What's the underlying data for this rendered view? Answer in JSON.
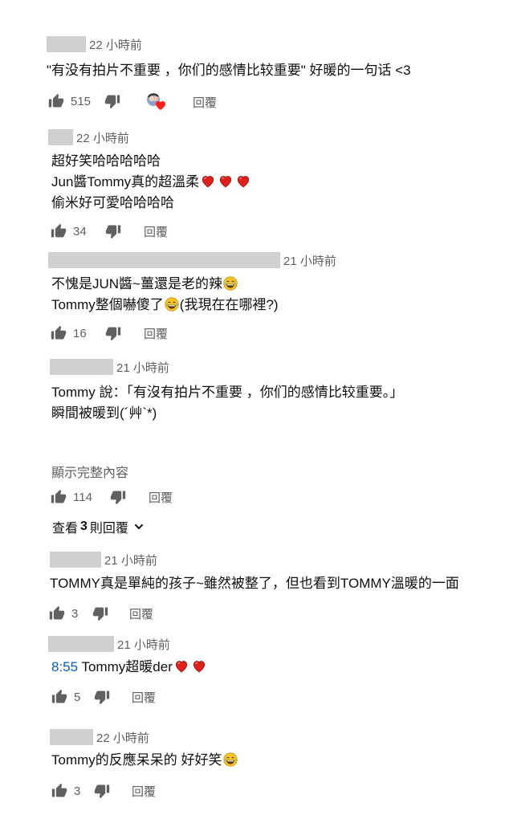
{
  "comments": [
    {
      "time": "22 小時前",
      "lines": [
        "\"有没有拍片不重要 ，你们的感情比较重要\" 好暖的一句话 <3"
      ],
      "likes": "515",
      "reply_label": "回覆",
      "creator_heart": true
    },
    {
      "time": "22 小時前",
      "lines": [
        "超好笑哈哈哈哈哈",
        "Jun醬Tommy真的超溫柔",
        "偷米好可愛哈哈哈哈"
      ],
      "likes": "34",
      "reply_label": "回覆"
    },
    {
      "time": "21 小時前",
      "lines": [
        "不愧是JUN醬~薑還是老的辣",
        "Tommy整個嚇傻了",
        "(我現在在哪裡?)"
      ],
      "likes": "16",
      "reply_label": "回覆"
    },
    {
      "time": "21 小時前",
      "lines": [
        "Tommy 說：「有沒有拍片不重要 ，你们的感情比较重要。」",
        "瞬間被暖到(´艸`*)"
      ],
      "show_more": "顯示完整內容",
      "likes": "114",
      "reply_label": "回覆",
      "view_replies": {
        "prefix": "查看",
        "count": "3",
        "suffix": "則回覆"
      }
    },
    {
      "time": "21 小時前",
      "lines": [
        "TOMMY真是單純的孩子~雖然被整了，但也看到TOMMY溫暖的一面"
      ],
      "likes": "3",
      "reply_label": "回覆"
    },
    {
      "time": "21 小時前",
      "timestamp_link": "8:55",
      "lines": [
        "Tommy超暖der"
      ],
      "likes": "5",
      "reply_label": "回覆"
    },
    {
      "time": "22 小時前",
      "lines": [
        "Tommy的反應呆呆的 好好笑"
      ],
      "likes": "3",
      "reply_label": "回覆"
    }
  ],
  "colors": {
    "text": "#0f0f0f",
    "secondary": "#606060",
    "link": "#065fd4",
    "heart": "#e0211b",
    "redacted": "#cfcfcf"
  },
  "icons": [
    "thumb-up-icon",
    "thumb-down-icon",
    "heart-emoji-icon",
    "laughing-emoji-icon",
    "chevron-down-icon",
    "creator-heart-icon"
  ]
}
